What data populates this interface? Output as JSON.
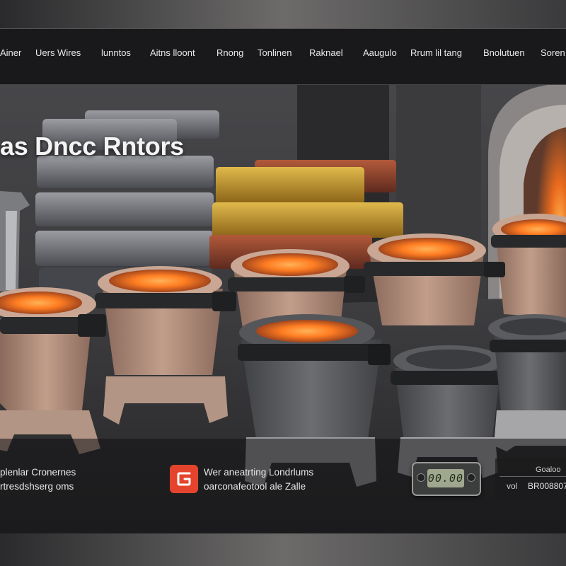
{
  "nav": {
    "items": [
      {
        "label": "Ainer"
      },
      {
        "label": "Uers Wires"
      },
      {
        "label": "lunntos"
      },
      {
        "label": "Aitns lloont"
      },
      {
        "label": "Rnong"
      },
      {
        "label": "Tonlinen"
      },
      {
        "label": "Raknael"
      },
      {
        "label": "Aaugulo"
      },
      {
        "label": "Rrum lil tang"
      },
      {
        "label": "Bnolutuen"
      },
      {
        "label": "Soren"
      }
    ]
  },
  "hero": {
    "title": "as Dncc Rntors"
  },
  "features": [
    {
      "line1": "plenlar Cronernes",
      "line2": "rtresdshserg oms"
    },
    {
      "line1": "Wer aneatrting Londrlums",
      "line2": "oarconafeotool ale Zalle"
    }
  ],
  "icons": {
    "feature_icon": "logo-square-icon",
    "scale": "digital-scale-icon"
  },
  "scale": {
    "display": "00.00"
  },
  "specs": {
    "label1": "Goaloo",
    "value_label": "vol",
    "value": "BR008807"
  },
  "colors": {
    "accent": "#e4442e",
    "nav_background": "#161618",
    "gold_bar": "#c2962f",
    "copper_bar": "#8e4530",
    "silver_bar": "#6c6e74",
    "crucible_clay": "#b48f7d",
    "crucible_graphite": "#5a5b5d",
    "molten_glow": "#ff8a2c"
  }
}
